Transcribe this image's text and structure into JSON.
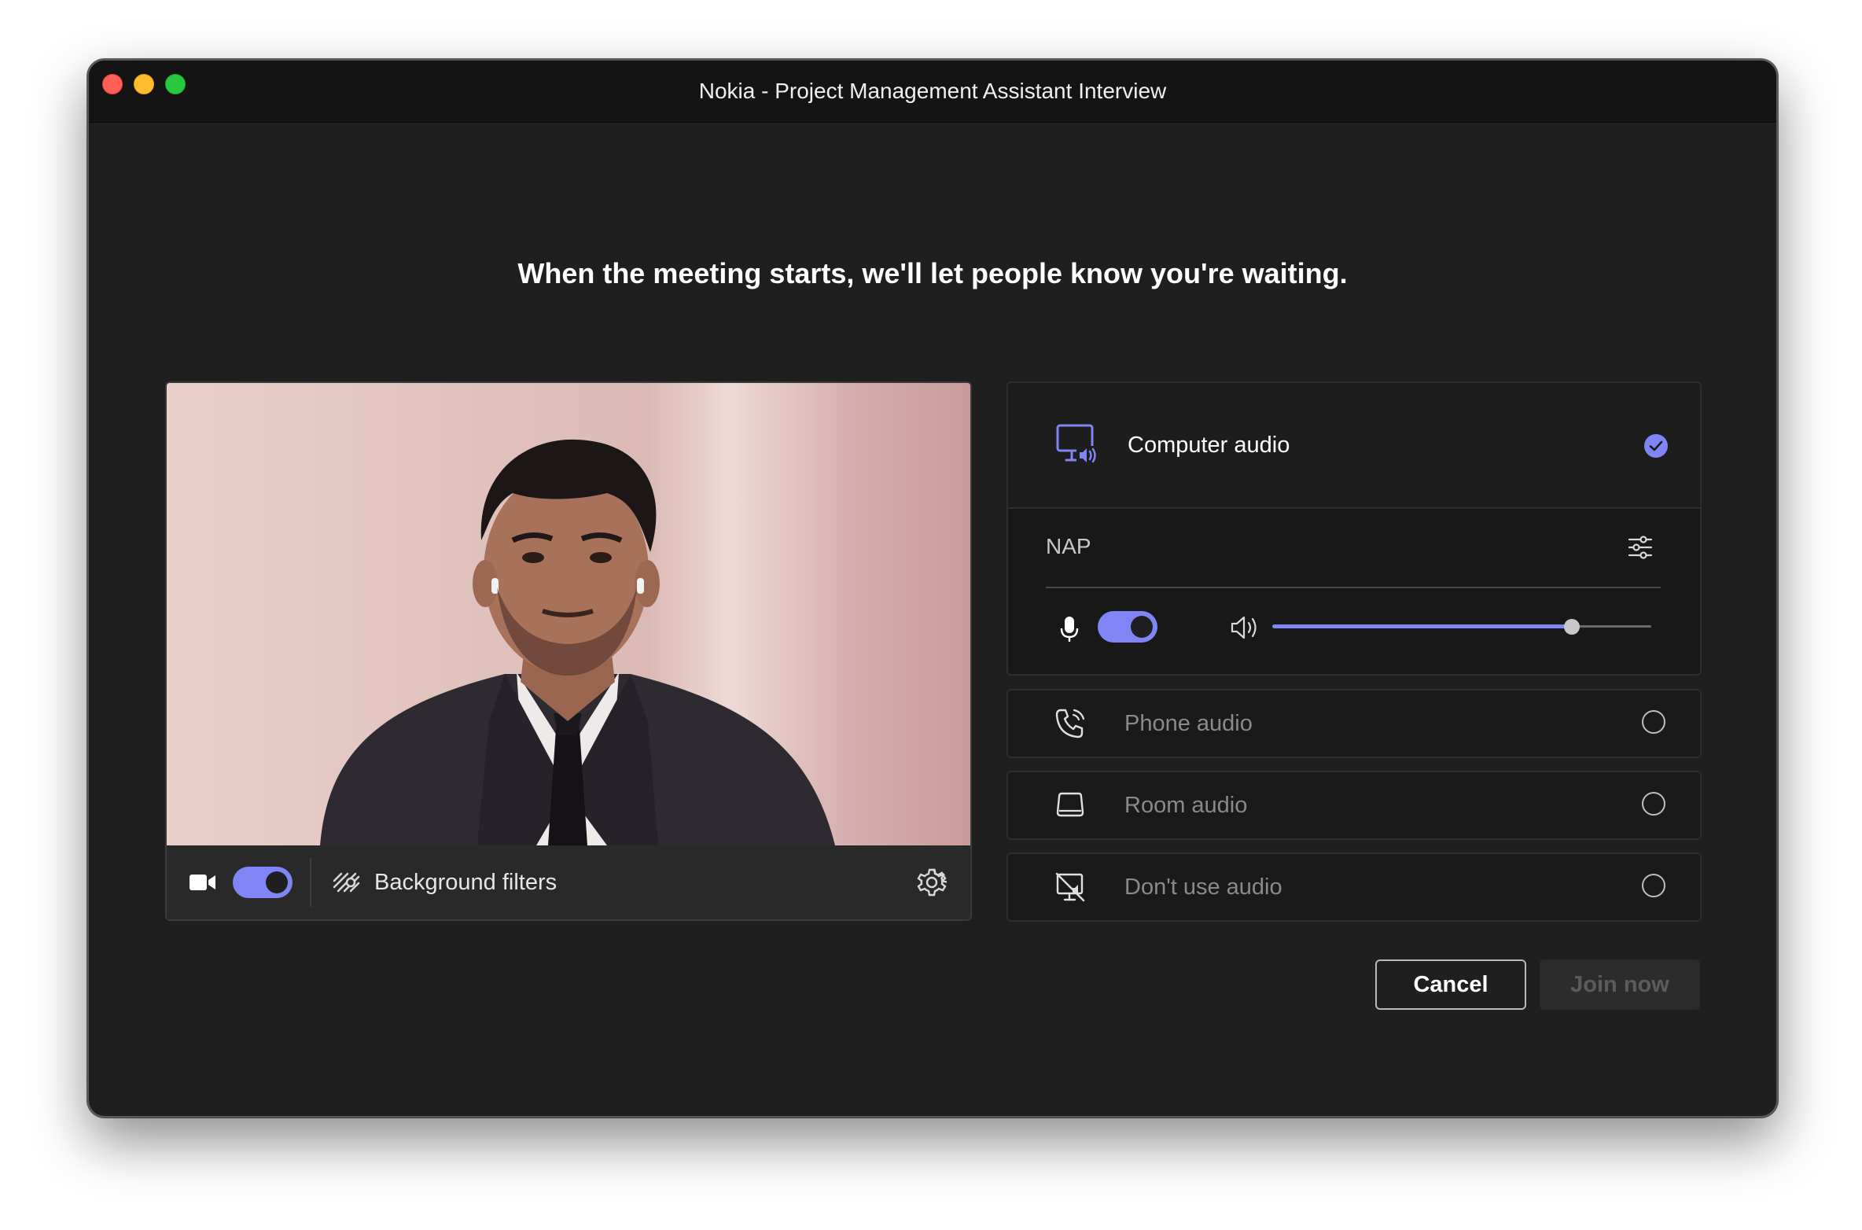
{
  "window": {
    "title": "Nokia - Project Management Assistant Interview"
  },
  "headline": "When the meeting starts, we'll let people know you're waiting.",
  "video": {
    "camera_on": true,
    "background_filters_label": "Background filters"
  },
  "audio": {
    "computer_audio": {
      "label": "Computer audio",
      "selected": true,
      "device_name": "NAP",
      "mic_on": true,
      "volume_level": 0.79
    },
    "options": [
      {
        "label": "Phone audio",
        "icon": "phone-audio-icon",
        "selected": false
      },
      {
        "label": "Room audio",
        "icon": "room-audio-icon",
        "selected": false
      },
      {
        "label": "Don't use audio",
        "icon": "no-audio-icon",
        "selected": false
      }
    ]
  },
  "buttons": {
    "cancel": "Cancel",
    "join": "Join now"
  },
  "colors": {
    "accent": "#7f85f5",
    "window_bg": "#1f1f1f",
    "titlebar_bg": "#141414"
  }
}
